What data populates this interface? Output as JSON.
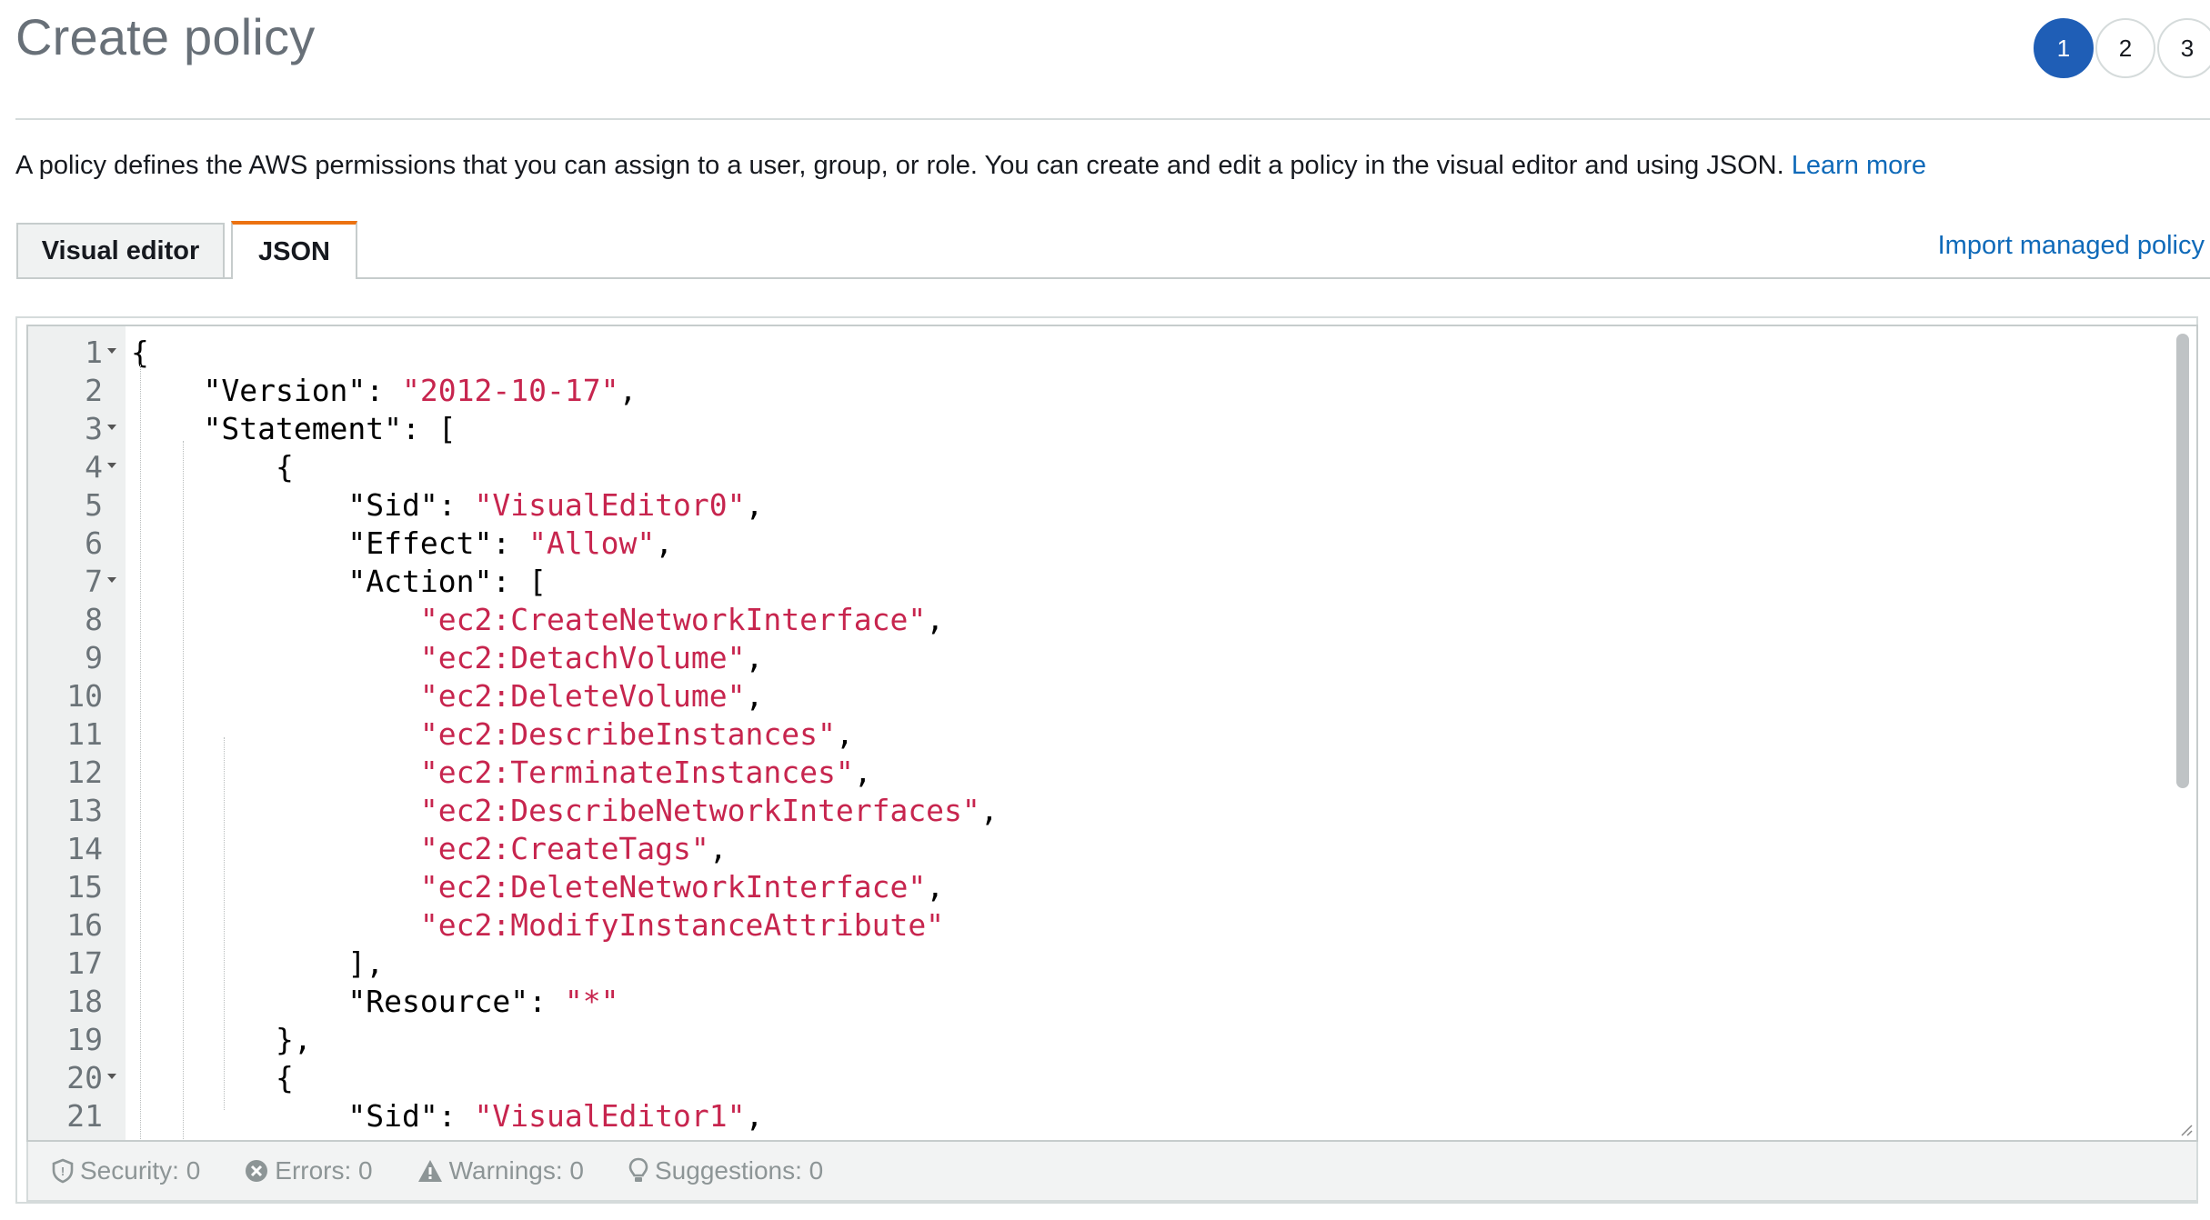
{
  "page": {
    "title": "Create policy"
  },
  "steps": [
    {
      "label": "1",
      "active": true
    },
    {
      "label": "2",
      "active": false
    },
    {
      "label": "3",
      "active": false
    }
  ],
  "intro": {
    "text": "A policy defines the AWS permissions that you can assign to a user, group, or role. You can create and edit a policy in the visual editor and using JSON. ",
    "learn_more": "Learn more"
  },
  "tabs": {
    "visual_editor": "Visual editor",
    "json": "JSON",
    "active": "JSON"
  },
  "import_link": "Import managed policy",
  "editor": {
    "lines": [
      {
        "n": "1",
        "fold": true,
        "indent": 0,
        "parts": [
          [
            "p",
            "{"
          ]
        ]
      },
      {
        "n": "2",
        "fold": false,
        "indent": 1,
        "parts": [
          [
            "p",
            "\"Version\": "
          ],
          [
            "s",
            "\"2012-10-17\""
          ],
          [
            "p",
            ","
          ]
        ]
      },
      {
        "n": "3",
        "fold": true,
        "indent": 1,
        "parts": [
          [
            "p",
            "\"Statement\": ["
          ]
        ]
      },
      {
        "n": "4",
        "fold": true,
        "indent": 2,
        "parts": [
          [
            "p",
            "{"
          ]
        ]
      },
      {
        "n": "5",
        "fold": false,
        "indent": 3,
        "parts": [
          [
            "p",
            "\"Sid\": "
          ],
          [
            "s",
            "\"VisualEditor0\""
          ],
          [
            "p",
            ","
          ]
        ]
      },
      {
        "n": "6",
        "fold": false,
        "indent": 3,
        "parts": [
          [
            "p",
            "\"Effect\": "
          ],
          [
            "s",
            "\"Allow\""
          ],
          [
            "p",
            ","
          ]
        ]
      },
      {
        "n": "7",
        "fold": true,
        "indent": 3,
        "parts": [
          [
            "p",
            "\"Action\": ["
          ]
        ]
      },
      {
        "n": "8",
        "fold": false,
        "indent": 4,
        "parts": [
          [
            "s",
            "\"ec2:CreateNetworkInterface\""
          ],
          [
            "p",
            ","
          ]
        ]
      },
      {
        "n": "9",
        "fold": false,
        "indent": 4,
        "parts": [
          [
            "s",
            "\"ec2:DetachVolume\""
          ],
          [
            "p",
            ","
          ]
        ]
      },
      {
        "n": "10",
        "fold": false,
        "indent": 4,
        "parts": [
          [
            "s",
            "\"ec2:DeleteVolume\""
          ],
          [
            "p",
            ","
          ]
        ]
      },
      {
        "n": "11",
        "fold": false,
        "indent": 4,
        "parts": [
          [
            "s",
            "\"ec2:DescribeInstances\""
          ],
          [
            "p",
            ","
          ]
        ]
      },
      {
        "n": "12",
        "fold": false,
        "indent": 4,
        "parts": [
          [
            "s",
            "\"ec2:TerminateInstances\""
          ],
          [
            "p",
            ","
          ]
        ]
      },
      {
        "n": "13",
        "fold": false,
        "indent": 4,
        "parts": [
          [
            "s",
            "\"ec2:DescribeNetworkInterfaces\""
          ],
          [
            "p",
            ","
          ]
        ]
      },
      {
        "n": "14",
        "fold": false,
        "indent": 4,
        "parts": [
          [
            "s",
            "\"ec2:CreateTags\""
          ],
          [
            "p",
            ","
          ]
        ]
      },
      {
        "n": "15",
        "fold": false,
        "indent": 4,
        "parts": [
          [
            "s",
            "\"ec2:DeleteNetworkInterface\""
          ],
          [
            "p",
            ","
          ]
        ]
      },
      {
        "n": "16",
        "fold": false,
        "indent": 4,
        "parts": [
          [
            "s",
            "\"ec2:ModifyInstanceAttribute\""
          ]
        ]
      },
      {
        "n": "17",
        "fold": false,
        "indent": 3,
        "parts": [
          [
            "p",
            "],"
          ]
        ]
      },
      {
        "n": "18",
        "fold": false,
        "indent": 3,
        "parts": [
          [
            "p",
            "\"Resource\": "
          ],
          [
            "s",
            "\"*\""
          ]
        ]
      },
      {
        "n": "19",
        "fold": false,
        "indent": 2,
        "parts": [
          [
            "p",
            "},"
          ]
        ]
      },
      {
        "n": "20",
        "fold": true,
        "indent": 2,
        "parts": [
          [
            "p",
            "{"
          ]
        ]
      },
      {
        "n": "21",
        "fold": false,
        "indent": 3,
        "parts": [
          [
            "p",
            "\"Sid\": "
          ],
          [
            "s",
            "\"VisualEditor1\""
          ],
          [
            "p",
            ","
          ]
        ]
      }
    ]
  },
  "status_bar": {
    "security": "Security: 0",
    "errors": "Errors: 0",
    "warnings": "Warnings: 0",
    "suggestions": "Suggestions: 0"
  },
  "colors": {
    "primary": "#1f5eb6",
    "link": "#0f6ab9",
    "tab_accent": "#ec7211",
    "string": "#c7254e"
  }
}
